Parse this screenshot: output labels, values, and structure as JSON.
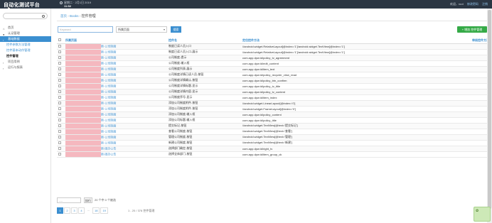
{
  "topbar": {
    "logo": "自动化测试平台",
    "date": "星期二 · 2月1日 2019",
    "time": "11:52",
    "user": "欢迎，root",
    "change_password": "修改密码",
    "logout": "注销"
  },
  "sidebar": {
    "search_placeholder": "",
    "items": [
      {
        "label": "首页",
        "icon": "home-icon"
      },
      {
        "label": "认证管理",
        "icon": "user-icon"
      },
      {
        "label": "基础数据",
        "icon": "chevron-right-icon"
      },
      {
        "label": "控件参数方法管理"
      },
      {
        "label": "控件基本动作管理"
      },
      {
        "label": "控件管理"
      },
      {
        "label": "项目用例",
        "icon": "chevron-right-icon"
      },
      {
        "label": "运行与报表",
        "icon": "chevron-right-icon"
      }
    ]
  },
  "breadcrumb": {
    "home": "首页",
    "sep1": "›",
    "books": "Books",
    "sep2": "›",
    "title": "控件管理"
  },
  "filters": {
    "keyword_placeholder": "Keyword",
    "select_value": "所属页面",
    "search_button": "搜索",
    "add_button": "+ 增加 控件管理"
  },
  "table": {
    "headers": [
      "所属页面",
      "控件名",
      "定位控件方法",
      "审核控件方法"
    ],
    "rows": [
      {
        "biz": "新-公司制度",
        "name": "制度已读人员入口",
        "loc": "//android.widget.RelativeLayout[@index='1']/android.widget.TextView[@index='1']"
      },
      {
        "biz": "新-公司制度",
        "name": "制度已读人员入口-展示",
        "loc": "//android.widget.RelativeLayout[@index='1']/android.widget.TextView[@index='1']"
      },
      {
        "biz": "新-公司制度",
        "name": "公司制度-提示",
        "loc": "com.app.dpw:id/policy_tv_agreement"
      },
      {
        "biz": "新-公司制度",
        "name": "公司制度-输入框",
        "loc": "com.app.dpw:id/edit_content"
      },
      {
        "biz": "新-公司制度",
        "name": "公司制度列表-展示",
        "loc": "com.app.dpw:id/item_text"
      },
      {
        "biz": "新-公司制度",
        "name": "公司制度详情已读人员-按钮",
        "loc": "com.app.dpw:id/policy_recycler_view_read"
      },
      {
        "biz": "新-公司制度",
        "name": "公司制度详情确认-按钮",
        "loc": "com.app.dpw:id/policy_btn_confirm"
      },
      {
        "biz": "新-公司制度",
        "name": "公司制度详情标题-显示",
        "loc": "com.app.dpw:id/policy_tv_title"
      },
      {
        "biz": "新-公司制度",
        "name": "公司制度详情内容-显示",
        "loc": "com.app.dpw:id/policy_tv_content"
      },
      {
        "biz": "新-公司制度",
        "name": "公司制度序号-显示",
        "loc": "com.app.dpw:id/item_index"
      },
      {
        "biz": "新-公司制度",
        "name": "添加公司制度附件-按钮",
        "loc": "//android.widget.LinearLayout[@index='0']"
      },
      {
        "biz": "新-公司制度",
        "name": "添加公司制度附件-按钮",
        "loc": "//android.widget.FrameLayout[@index='0']"
      },
      {
        "biz": "新-公司制度",
        "name": "添加公司制度-输入框",
        "loc": "com.app.dpw:id/policy_content"
      },
      {
        "biz": "新-公司制度",
        "name": "添加公司标题-输入框",
        "loc": "com.app.dpw:id/policy_title"
      },
      {
        "biz": "新-公司制度",
        "name": "提交标记-按钮",
        "loc": "//android.widget.TextView[@text='提交标记']"
      },
      {
        "biz": "新-公司制度",
        "name": "查看公司制度-按钮",
        "loc": "//android.widget.TextView[@text='查看']"
      },
      {
        "biz": "新-公司制度",
        "name": "管理公司制度-按钮",
        "loc": "//android.widget.TextView[@text='管理']"
      },
      {
        "biz": "新-公司制度",
        "name": "新建公司制度-按钮",
        "loc": "//android.widget.TextView[@text='新建']"
      },
      {
        "biz": "新-团办公告",
        "name": "选择部门确定-按钮",
        "loc": "com.app.dpw:id/right_tv"
      },
      {
        "biz": "新-团办公告",
        "name": "选择全体部门-按钮",
        "loc": "com.app.dpw:id/item_group_ck"
      }
    ]
  },
  "pager": {
    "page_size_value": "----",
    "go_button": "执行",
    "info": "20 个中 0 个被选",
    "pages": [
      "1",
      "2",
      "3",
      "4",
      "...",
      "18",
      "19"
    ],
    "current": "1",
    "total": "1 - 20 / 378 控件管理"
  },
  "colors": {
    "accent": "#3b8fd0",
    "topbar": "#2b3643",
    "add_button": "#35aa47",
    "redaction": "#f5b8bf"
  }
}
